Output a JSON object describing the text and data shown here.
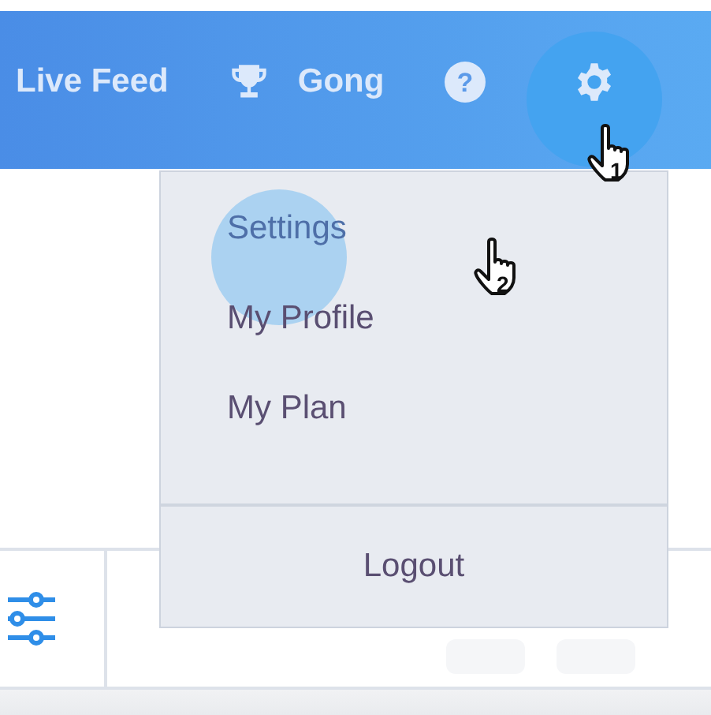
{
  "top_nav": {
    "items": [
      {
        "kind": "link",
        "label": "Live Feed"
      },
      {
        "kind": "trophy",
        "label": "Gong"
      },
      {
        "kind": "help",
        "label": "?"
      },
      {
        "kind": "settings",
        "selected": true
      }
    ]
  },
  "user_menu": {
    "items": [
      {
        "label": "Settings",
        "selected": true
      },
      {
        "label": "My Profile",
        "selected": false
      },
      {
        "label": "My Plan",
        "selected": false
      }
    ],
    "footer": "Logout"
  },
  "cursor_markers": [
    {
      "label": "1"
    },
    {
      "label": "2"
    }
  ]
}
